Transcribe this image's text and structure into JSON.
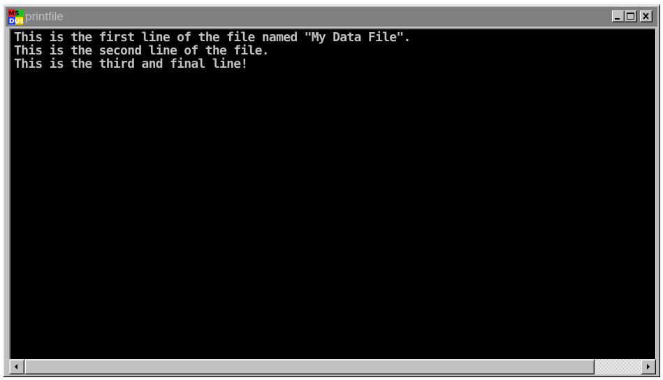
{
  "window": {
    "title": "printfile",
    "icon": "ms-dos-app-icon",
    "controls": {
      "minimize": "minimize-icon",
      "maximize": "maximize-icon",
      "close": "close-icon"
    }
  },
  "console": {
    "lines": [
      "This is the first line of the file named \"My Data File\".",
      "This is the second line of the file.",
      "This is the third and final line!"
    ],
    "text_color": "#c0c0c0",
    "background": "#000000"
  },
  "scrollbar": {
    "left_arrow": "arrow-left-icon",
    "right_arrow": "arrow-right-icon"
  },
  "colors": {
    "titlebar_inactive": "#808080",
    "title_text": "#c0c0c0",
    "chrome": "#c0c0c0"
  }
}
